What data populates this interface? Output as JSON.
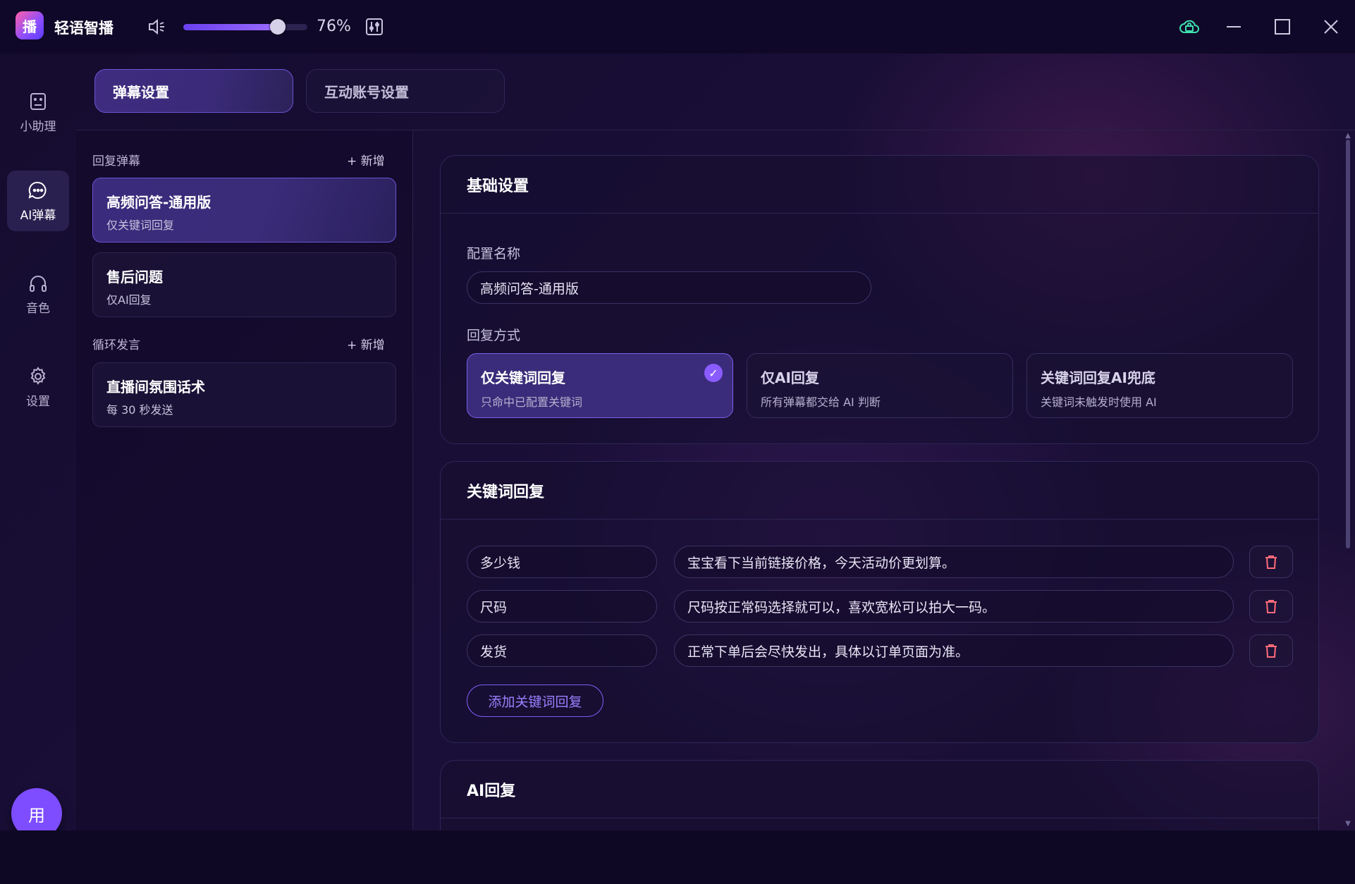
{
  "app": {
    "logo_char": "播",
    "title": "轻语智播"
  },
  "volume": {
    "level": 0.76,
    "text": "76%"
  },
  "sidebar": {
    "items": [
      {
        "label": "小助理",
        "icon": "assistant-icon"
      },
      {
        "label": "AI弹幕",
        "icon": "chat-bubble-icon",
        "active": true
      },
      {
        "label": "音色",
        "icon": "headphones-icon"
      },
      {
        "label": "设置",
        "icon": "gear-icon"
      }
    ],
    "avatar": "用"
  },
  "tabs": [
    {
      "label": "弹幕设置",
      "active": true
    },
    {
      "label": "互动账号设置",
      "active": false
    }
  ],
  "config_list": {
    "reply_group": {
      "label": "回复弹幕",
      "add": "+ 新增"
    },
    "reply_items": [
      {
        "title": "高频问答-通用版",
        "sub": "仅关键词回复",
        "active": true
      },
      {
        "title": "售后问题",
        "sub": "仅AI回复",
        "active": false
      }
    ],
    "loop_group": {
      "label": "循环发言",
      "add": "+ 新增"
    },
    "loop_items": [
      {
        "title": "直播间氛围话术",
        "sub": "每 30 秒发送"
      }
    ]
  },
  "basic": {
    "heading": "基础设置",
    "name_label": "配置名称",
    "name_value": "高频问答-通用版",
    "mode_label": "回复方式",
    "modes": [
      {
        "title": "仅关键词回复",
        "desc": "只命中已配置关键词",
        "selected": true
      },
      {
        "title": "仅AI回复",
        "desc": "所有弹幕都交给 AI 判断",
        "selected": false
      },
      {
        "title": "关键词回复AI兜底",
        "desc": "关键词未触发时使用 AI",
        "selected": false
      }
    ],
    "check_mark": "✓"
  },
  "keywords": {
    "heading": "关键词回复",
    "rows": [
      {
        "keyword": "多少钱",
        "reply": "宝宝看下当前链接价格，今天活动价更划算。"
      },
      {
        "keyword": "尺码",
        "reply": "尺码按正常码选择就可以，喜欢宽松可以拍大一码。"
      },
      {
        "keyword": "发货",
        "reply": "正常下单后会尽快发出，具体以订单页面为准。"
      }
    ],
    "add_label": "添加关键词回复"
  },
  "ai": {
    "heading": "AI回复"
  },
  "colors": {
    "accent": "#7d4dff",
    "bg": "#150c2f",
    "delete": "#ff6b7a"
  }
}
